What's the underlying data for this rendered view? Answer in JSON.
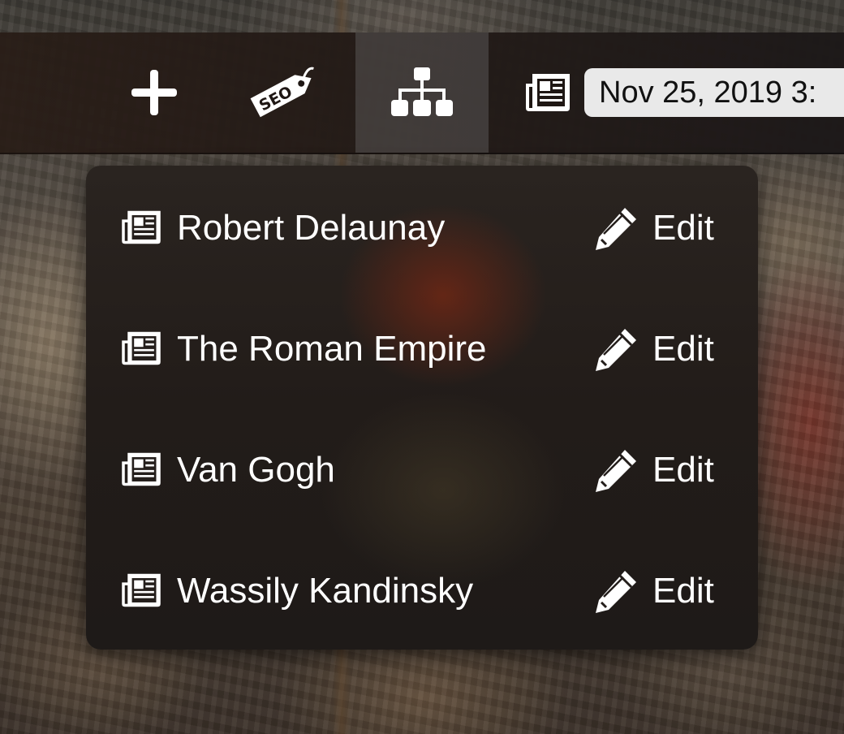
{
  "toolbar": {
    "add_icon": "plus-icon",
    "seo_icon": "seo-tag-icon",
    "seo_tag_text": "SEO",
    "sitemap_icon": "sitemap-icon",
    "news_icon": "newspaper-icon",
    "date_text": "Nov 25, 2019 3:"
  },
  "dropdown": {
    "items": [
      {
        "label": "Robert Delaunay",
        "edit_label": "Edit",
        "icon": "newspaper-icon"
      },
      {
        "label": "The Roman Empire",
        "edit_label": "Edit",
        "icon": "newspaper-icon"
      },
      {
        "label": "Van Gogh",
        "edit_label": "Edit",
        "icon": "newspaper-icon"
      },
      {
        "label": "Wassily Kandinsky",
        "edit_label": "Edit",
        "icon": "newspaper-icon"
      }
    ]
  },
  "colors": {
    "toolbar_bg": "#1f1714",
    "active_tab_bg": "#5a5555",
    "dropdown_bg": "#221c19",
    "date_pill_bg": "#e9e9e9",
    "text": "#ffffff"
  }
}
